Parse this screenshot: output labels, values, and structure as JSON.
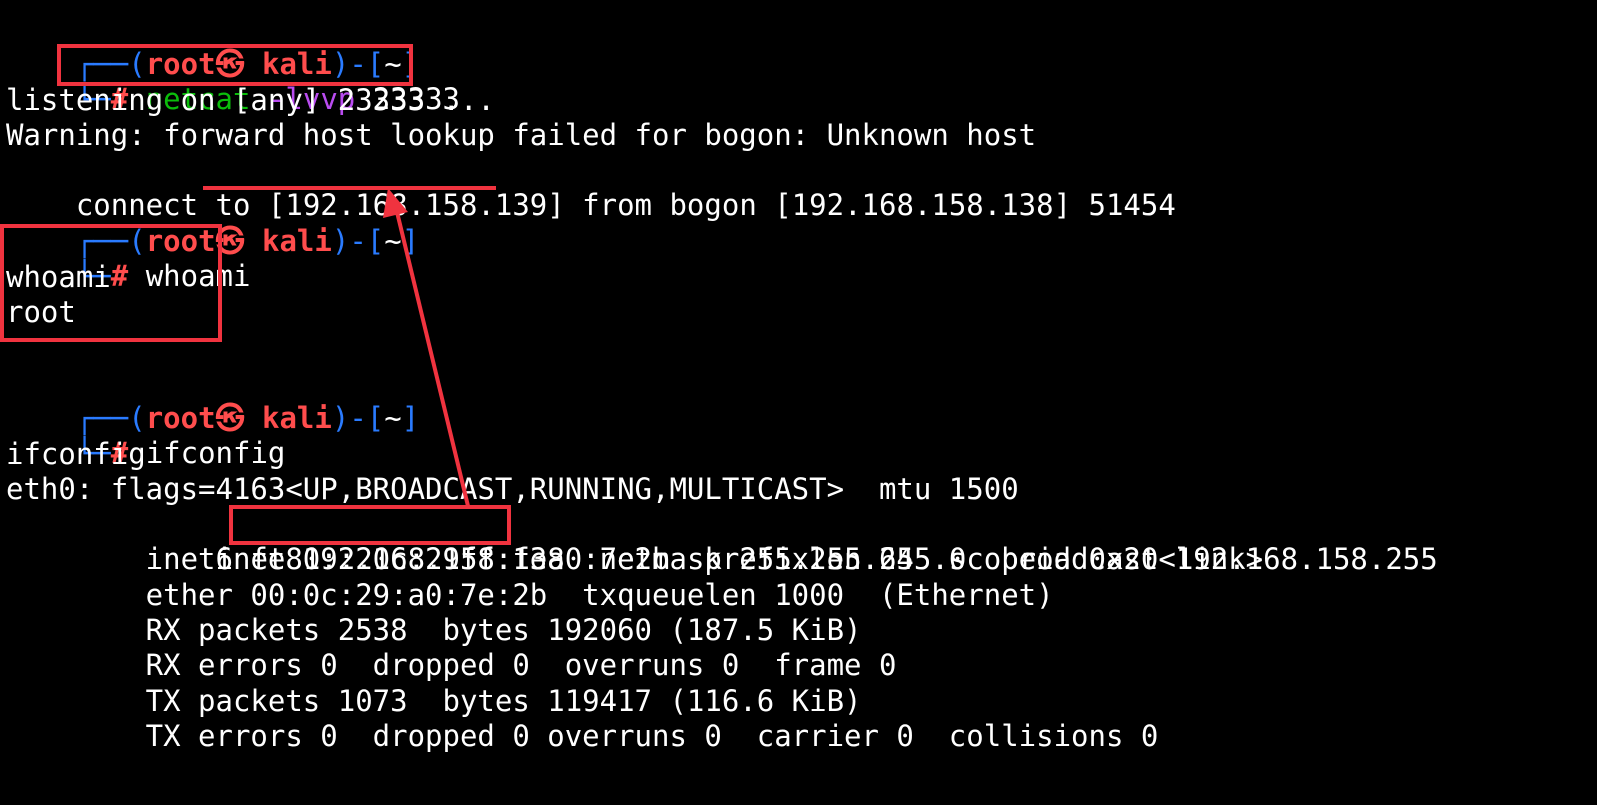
{
  "prompt": {
    "open_prefix": "┌──(",
    "user": "root",
    "at_symbol": "㉿",
    "host": "kali",
    "close_mid": ")-[",
    "path": "~",
    "close_suffix": "]",
    "cmd_prefix": "└─",
    "hash": "#"
  },
  "commands": {
    "netcat_bin": "netcat",
    "netcat_flags": "-lvvp",
    "netcat_port": "23333",
    "whoami": "whoami",
    "ifconfig": "ifconfig"
  },
  "output": {
    "listening": "listening on [any] 23333 ...",
    "warning": "Warning: forward host lookup failed for bogon: Unknown host",
    "connect_pre": "connect to ",
    "connect_ip": "[192.168.158.139]",
    "connect_post": " from bogon [192.168.158.138] 51454",
    "whoami_echo": "whoami",
    "whoami_result": "root",
    "ifconfig_echo": "ifconfig",
    "eth0": "eth0: flags=4163<UP,BROADCAST,RUNNING,MULTICAST>  mtu 1500",
    "inet_pre": "        inet ",
    "inet_ip": "192.168.158.138",
    "inet_post": "  netmask 255.255.255.0  broadcast 192.168.158.255",
    "inet6": "        inet6 fe80::20c:29ff:fea0:7e2b  prefixlen 64  scopeid 0x20<link>",
    "ether": "        ether 00:0c:29:a0:7e:2b  txqueuelen 1000  (Ethernet)",
    "rx_packets": "        RX packets 2538  bytes 192060 (187.5 KiB)",
    "rx_errors": "        RX errors 0  dropped 0  overruns 0  frame 0",
    "tx_packets": "        TX packets 1073  bytes 119417 (116.6 KiB)",
    "tx_errors": "        TX errors 0  dropped 0 overruns 0  carrier 0  collisions 0"
  },
  "colors": {
    "annotation": "#f0333f",
    "prompt_blue": "#2a7bff",
    "prompt_red": "#ff4d4d",
    "cmd_green": "#0bbd0b",
    "flag_purple": "#b94cf0"
  }
}
